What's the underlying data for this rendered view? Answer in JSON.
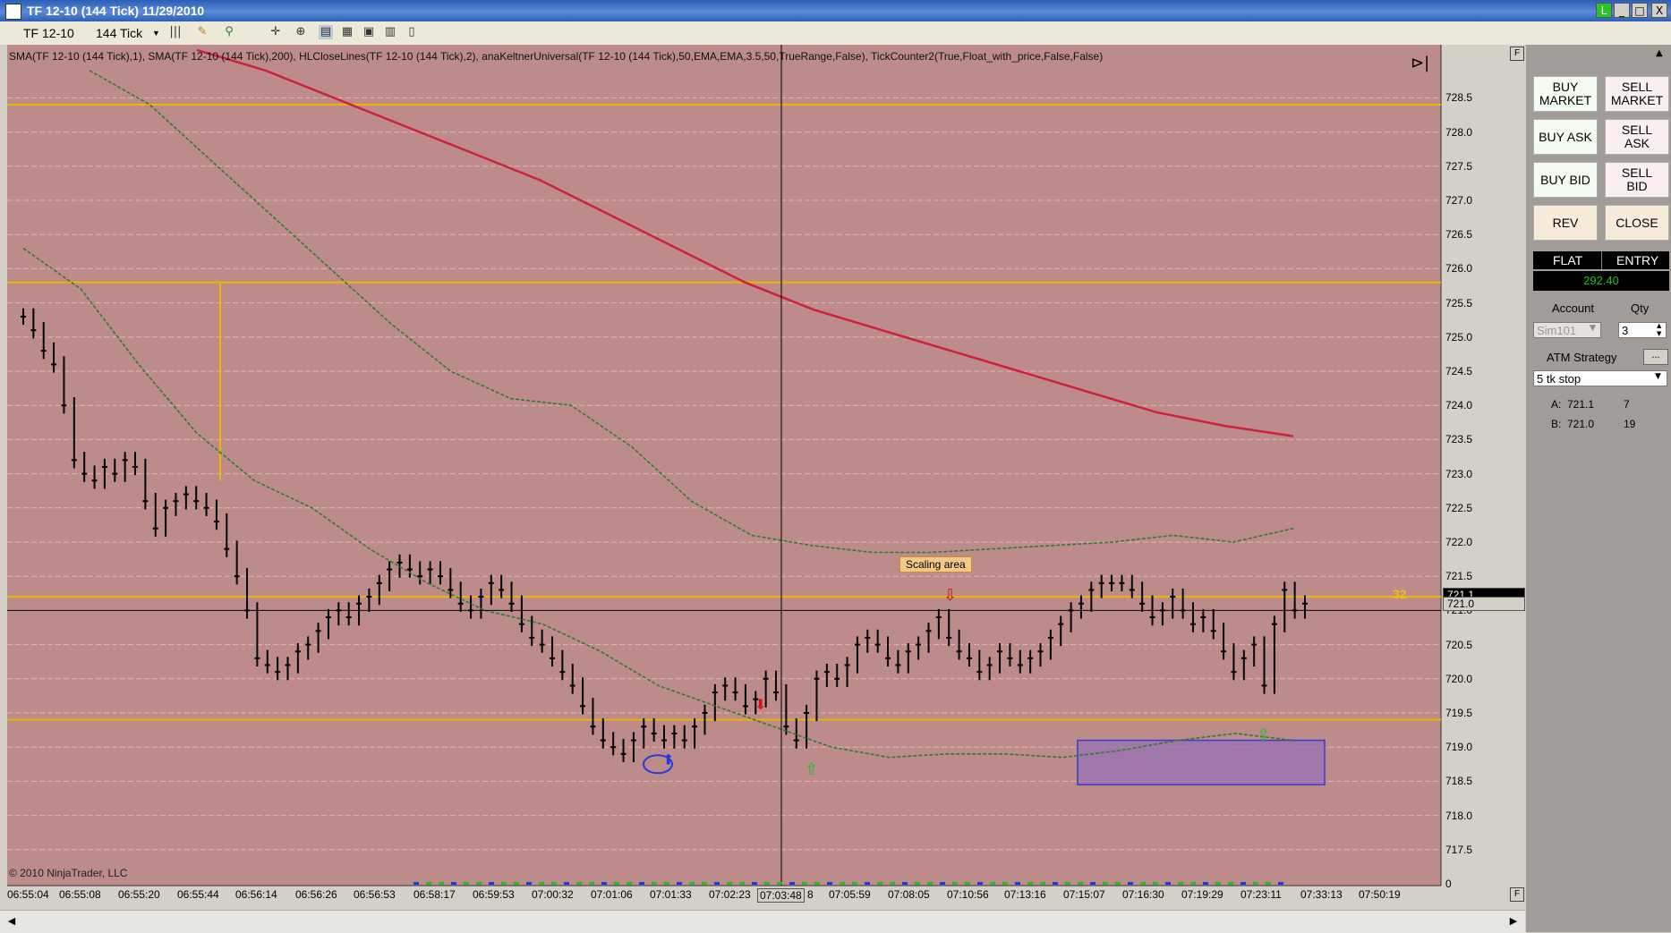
{
  "window": {
    "title": "TF 12-10 (144 Tick)  11/29/2010",
    "controls": [
      "L",
      "_",
      "□",
      "X"
    ]
  },
  "toolbar": {
    "instrument": "TF 12-10",
    "period": "144 Tick",
    "icons": [
      "bar-style-icon",
      "draw-pencil-icon",
      "crosshair-icon",
      "zoom-icon",
      "data-box-icon",
      "properties-icon",
      "chart-trader-icon"
    ]
  },
  "chart": {
    "indicators_label": "SMA(TF  12-10  (144  Tick),1),  SMA(TF  12-10  (144  Tick),200),  HLCloseLines(TF  12-10  (144  Tick),2),  anaKeltnerUniversal(TF  12-10  (144  Tick),50,EMA,EMA,3.5,50,TrueRange,False),  TickCounter2(True,Float_with_price,False,False)",
    "copyright": "© 2010 NinjaTrader, LLC",
    "scaling_area_label": "Scaling area",
    "tick_counter": "32",
    "current_price_label": "721.1",
    "cursor_price_label": "721.0",
    "cursor_time_label": "07:03:48",
    "y_ticks": [
      "728.5",
      "728.0",
      "727.5",
      "727.0",
      "726.5",
      "726.0",
      "725.5",
      "725.0",
      "724.5",
      "724.0",
      "723.5",
      "723.0",
      "722.5",
      "722.0",
      "721.5",
      "721.0",
      "720.5",
      "720.0",
      "719.5",
      "719.0",
      "718.5",
      "718.0",
      "717.5",
      "0"
    ],
    "x_ticks": [
      "06:55:04",
      "06:55:08",
      "06:55:20",
      "06:55:44",
      "06:56:14",
      "06:56:26",
      "06:56:53",
      "06:58:17",
      "06:59:53",
      "07:00:32",
      "07:01:06",
      "07:01:33",
      "07:02:23",
      "8",
      "07:05:59",
      "07:08:05",
      "07:10:56",
      "07:13:16",
      "07:15:07",
      "07:16:30",
      "07:19:29",
      "07:23:11",
      "07:33:13",
      "07:50:19"
    ],
    "colors": {
      "background": "#bc8b8a",
      "sma200": "#d0203a",
      "keltner": "#2e7d2e",
      "hl_lines": "#f0b400",
      "bars": "#000000",
      "scaling_box": "#9670b4"
    }
  },
  "chart_data": {
    "type": "bar",
    "title": "",
    "ylim": [
      717.0,
      729.0
    ],
    "closes": [
      725.3,
      725.1,
      724.8,
      724.6,
      724.0,
      723.2,
      723.0,
      722.9,
      723.1,
      723.0,
      723.2,
      723.1,
      722.6,
      722.2,
      722.5,
      722.6,
      722.7,
      722.6,
      722.5,
      722.3,
      721.9,
      721.5,
      721.0,
      720.3,
      720.2,
      720.1,
      720.2,
      720.4,
      720.5,
      720.7,
      720.9,
      721.0,
      720.9,
      721.1,
      721.2,
      721.4,
      721.6,
      721.7,
      721.6,
      721.5,
      721.6,
      721.5,
      721.3,
      721.1,
      721.0,
      721.2,
      721.4,
      721.3,
      721.1,
      720.8,
      720.6,
      720.5,
      720.3,
      720.1,
      719.9,
      719.6,
      719.3,
      719.1,
      719.0,
      718.9,
      719.1,
      719.3,
      719.2,
      719.1,
      719.2,
      719.1,
      719.3,
      719.5,
      719.8,
      719.9,
      719.8,
      719.6,
      719.7,
      720.0,
      719.8,
      719.3,
      719.1,
      719.5,
      720.0,
      720.1,
      720.0,
      720.2,
      720.5,
      720.6,
      720.5,
      720.3,
      720.2,
      720.4,
      720.5,
      720.7,
      720.9,
      720.6,
      720.4,
      720.3,
      720.1,
      720.2,
      720.4,
      720.3,
      720.2,
      720.3,
      720.4,
      720.6,
      720.8,
      721.0,
      721.1,
      721.3,
      721.4,
      721.4,
      721.4,
      721.3,
      721.1,
      720.9,
      721.0,
      721.2,
      721.0,
      720.8,
      720.9,
      720.7,
      720.4,
      720.1,
      720.3,
      720.5,
      719.9,
      720.8,
      721.3,
      721.0,
      721.1
    ],
    "sma200": [
      729.2,
      728.9,
      728.5,
      728.1,
      727.7,
      727.3,
      726.8,
      726.3,
      725.8,
      725.4,
      725.1,
      724.8,
      724.5,
      724.2,
      723.9,
      723.7,
      723.55
    ],
    "keltner_upper": [
      728.9,
      728.4,
      727.6,
      726.8,
      726.0,
      725.2,
      724.5,
      724.1,
      724.0,
      723.4,
      722.6,
      722.1,
      721.95,
      721.85,
      721.85,
      721.9,
      721.95,
      722.0,
      722.1,
      722.0,
      722.2
    ],
    "keltner_lower": [
      726.3,
      725.7,
      724.6,
      723.6,
      722.9,
      722.5,
      721.9,
      721.4,
      721.0,
      720.8,
      720.4,
      719.9,
      719.6,
      719.3,
      719.0,
      718.85,
      718.9,
      718.9,
      718.85,
      718.95,
      719.1,
      719.2,
      719.1
    ],
    "hl_lines": [
      728.4,
      725.8,
      721.2,
      719.4
    ],
    "annotations": [
      "Scaling area",
      "32"
    ]
  },
  "panel": {
    "buttons": [
      {
        "id": "buy-market",
        "label": "BUY\nMARKET"
      },
      {
        "id": "sell-market",
        "label": "SELL\nMARKET"
      },
      {
        "id": "buy-ask",
        "label": "BUY ASK"
      },
      {
        "id": "sell-ask",
        "label": "SELL\nASK"
      },
      {
        "id": "buy-bid",
        "label": "BUY BID"
      },
      {
        "id": "sell-bid",
        "label": "SELL\nBID"
      },
      {
        "id": "rev",
        "label": "REV"
      },
      {
        "id": "close",
        "label": "CLOSE"
      }
    ],
    "position": {
      "flat": "FLAT",
      "entry": "ENTRY",
      "pnl": "292.40"
    },
    "account_label": "Account",
    "account_value": "Sim101",
    "qty_label": "Qty",
    "qty_value": "3",
    "atm_label": "ATM Strategy",
    "atm_value": "5 tk stop",
    "ask_label": "A:",
    "ask_price": "721.1",
    "ask_size": "7",
    "bid_label": "B:",
    "bid_price": "721.0",
    "bid_size": "19"
  }
}
